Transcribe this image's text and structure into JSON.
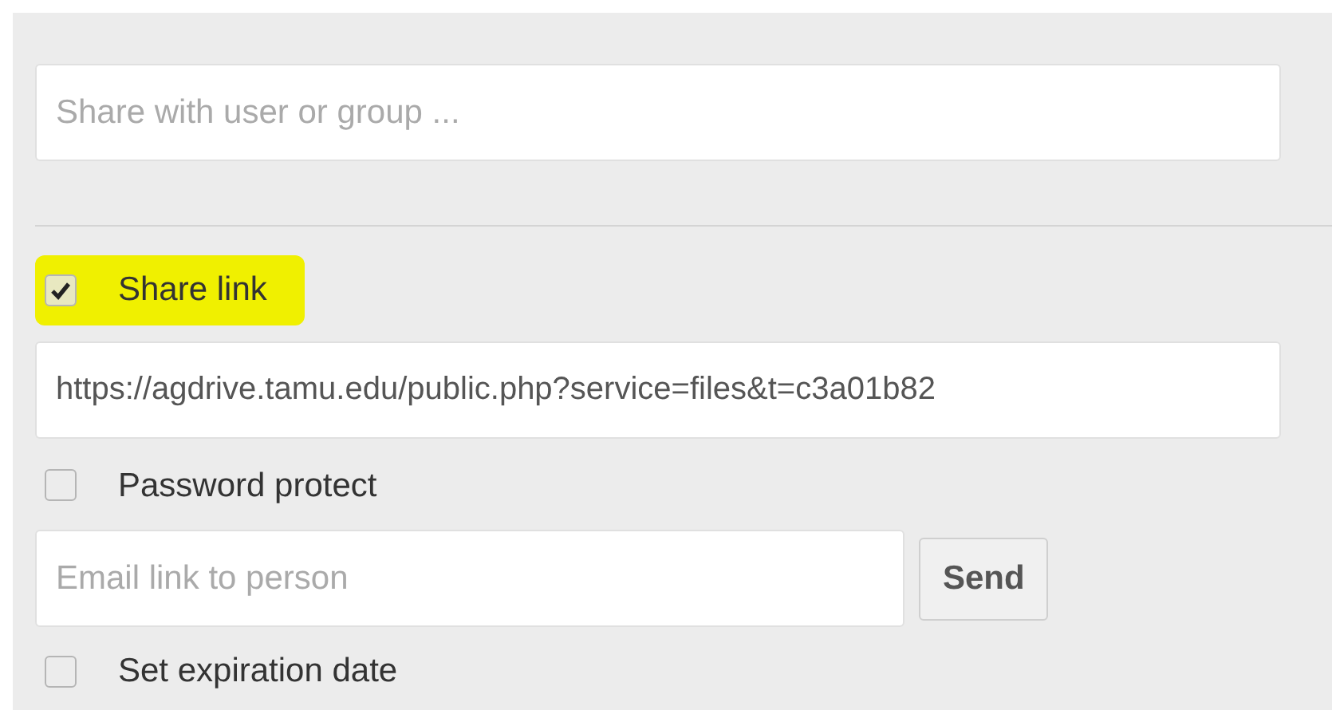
{
  "share_field": {
    "placeholder": "Share with user or group ..."
  },
  "share_link": {
    "label": "Share link",
    "checked": true,
    "highlighted": true
  },
  "link_field": {
    "value": "https://agdrive.tamu.edu/public.php?service=files&t=c3a01b82"
  },
  "password_protect": {
    "label": "Password protect",
    "checked": false
  },
  "email_field": {
    "placeholder": "Email link to person"
  },
  "send_button": {
    "label": "Send"
  },
  "expiration": {
    "label": "Set expiration date",
    "checked": false
  }
}
